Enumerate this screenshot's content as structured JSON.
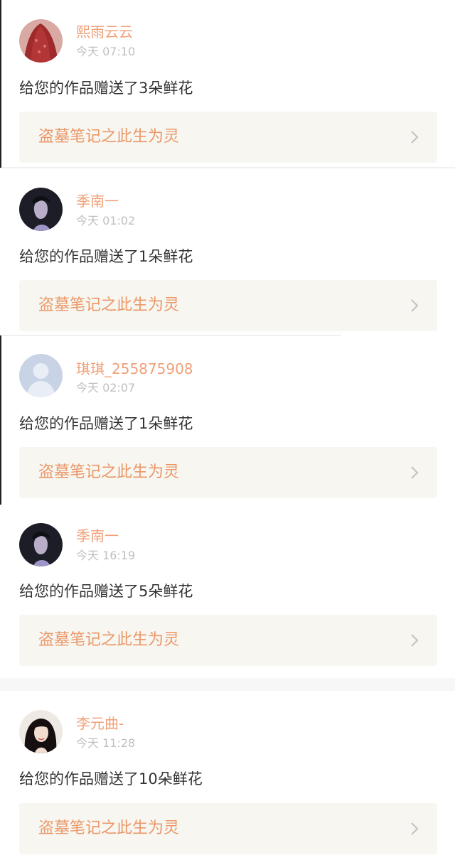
{
  "notifications": [
    {
      "username": "熙雨云云",
      "time": "今天 07:10",
      "message": "给您的作品赠送了3朵鲜花",
      "work_title": "盗墓笔记之此生为灵",
      "avatar": "red-veil-avatar"
    },
    {
      "username": "季南一",
      "time": "今天 01:02",
      "message": "给您的作品赠送了1朵鲜花",
      "work_title": "盗墓笔记之此生为灵",
      "avatar": "dark-profile-avatar"
    },
    {
      "username": "琪琪_255875908",
      "time": "今天 02:07",
      "message": "给您的作品赠送了1朵鲜花",
      "work_title": "盗墓笔记之此生为灵",
      "avatar": "default-user-avatar"
    },
    {
      "username": "季南一",
      "time": "今天 16:19",
      "message": "给您的作品赠送了5朵鲜花",
      "work_title": "盗墓笔记之此生为灵",
      "avatar": "dark-profile-avatar"
    },
    {
      "username": "李元曲-",
      "time": "今天 11:28",
      "message": "给您的作品赠送了10朵鲜花",
      "work_title": "盗墓笔记之此生为灵",
      "avatar": "girl-portrait-avatar"
    }
  ],
  "colors": {
    "username": "#f0a078",
    "timestamp": "#bfbfbf",
    "message": "#333333",
    "work_title": "#eb9868",
    "work_bg": "#f7f6f1",
    "chevron": "#c4c4c4"
  },
  "icons": {
    "chevron": "chevron-right-icon"
  }
}
